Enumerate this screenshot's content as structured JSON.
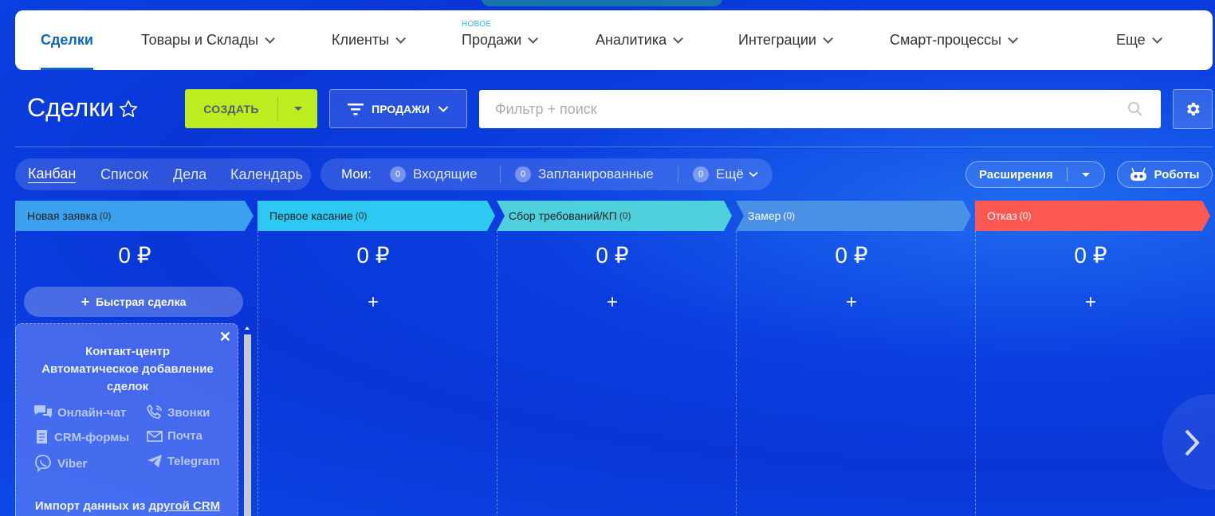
{
  "nav": {
    "items": [
      {
        "label": "Сделки",
        "active": true
      },
      {
        "label": "Товары и Склады"
      },
      {
        "label": "Клиенты"
      },
      {
        "label": "Продажи",
        "badge": "НОВОЕ"
      },
      {
        "label": "Аналитика"
      },
      {
        "label": "Интеграции"
      },
      {
        "label": "Смарт-процессы"
      },
      {
        "label": "Еще"
      }
    ]
  },
  "toolbar": {
    "title": "Сделки",
    "create_label": "СОЗДАТЬ",
    "sales_label": "ПРОДАЖИ",
    "search_placeholder": "Фильтр + поиск"
  },
  "views": {
    "items": [
      "Канбан",
      "Список",
      "Дела",
      "Календарь"
    ],
    "active": "Канбан"
  },
  "counters": {
    "label": "Мои:",
    "items": [
      {
        "count": "0",
        "label": "Входящие"
      },
      {
        "count": "0",
        "label": "Запланированные"
      },
      {
        "count": "0",
        "label": "Ещё"
      }
    ]
  },
  "extensions_label": "Расширения",
  "robots_label": "Роботы",
  "colors": {
    "accent": "#0b66c3",
    "create": "#bbed21",
    "stage_new": "#3ba0ee",
    "stage_first": "#2ec9f2",
    "stage_req": "#4fd0dd",
    "stage_measure": "#4a90e6",
    "stage_reject": "#ff5752"
  },
  "stages": [
    {
      "name": "Новая заявка",
      "count": "(0)",
      "sum": "0 ₽"
    },
    {
      "name": "Первое касание",
      "count": "(0)",
      "sum": "0 ₽",
      "plus": "+"
    },
    {
      "name": "Сбор требований/КП",
      "count": "(0)",
      "sum": "0 ₽",
      "plus": "+"
    },
    {
      "name": "Замер",
      "count": "(0)",
      "sum": "0 ₽",
      "plus": "+"
    },
    {
      "name": "Отказ",
      "count": "(0)",
      "sum": "0 ₽",
      "plus": "+"
    }
  ],
  "quick_deal_label": "Быстрая сделка",
  "promo": {
    "title1": "Контакт-центр",
    "title2": "Автоматическое добавление",
    "title3": "сделок",
    "channels": [
      "Онлайн-чат",
      "Звонки",
      "CRM-формы",
      "Почта",
      "Viber",
      "Telegram"
    ],
    "import_prefix": "Импорт данных из ",
    "import_link": "другой CRM"
  }
}
